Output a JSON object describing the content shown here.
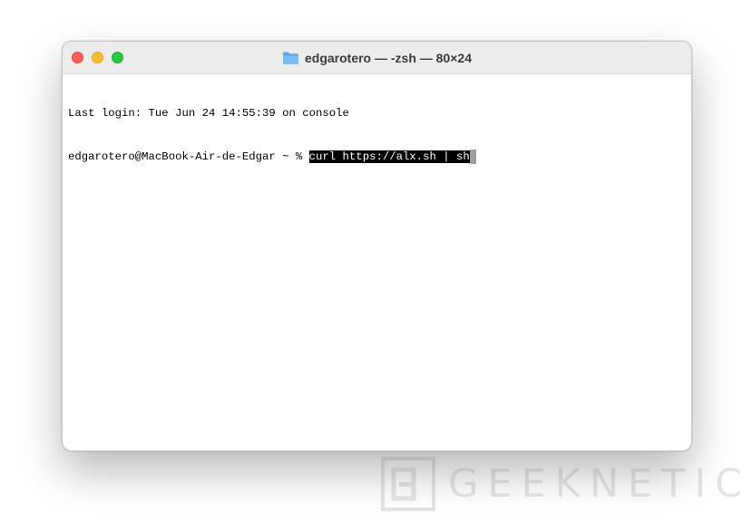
{
  "window": {
    "title": "edgarotero — -zsh — 80×24",
    "title_icon": "folder-icon",
    "traffic_lights": {
      "close": "#fe5f57",
      "minimize": "#febc2e",
      "zoom": "#28c840"
    }
  },
  "terminal": {
    "last_login": "Last login: Tue Jun 24 14:55:39 on console",
    "prompt": "edgarotero@MacBook-Air-de-Edgar ~ % ",
    "command": "curl https://alx.sh | sh"
  },
  "watermark": {
    "text": "GEEKNETIC",
    "logo": "geeknetic-logo"
  }
}
